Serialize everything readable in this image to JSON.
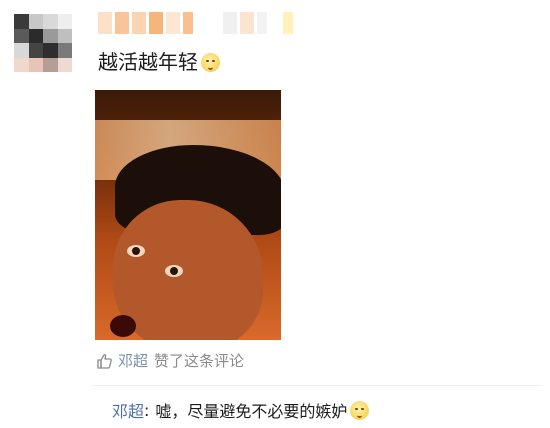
{
  "post": {
    "text": "越活越年轻",
    "emoji": "smirk-emoji"
  },
  "likes": {
    "user": "邓超",
    "action": "赞了这条评论"
  },
  "reply": {
    "user": "邓超",
    "colon": ":",
    "text": "嘘，尽量避免不必要的嫉妒",
    "emoji": "smirk-emoji"
  },
  "colors": {
    "link": "#4f6fa8",
    "muted": "#8a8a8a",
    "accent": "#f6d35a"
  }
}
